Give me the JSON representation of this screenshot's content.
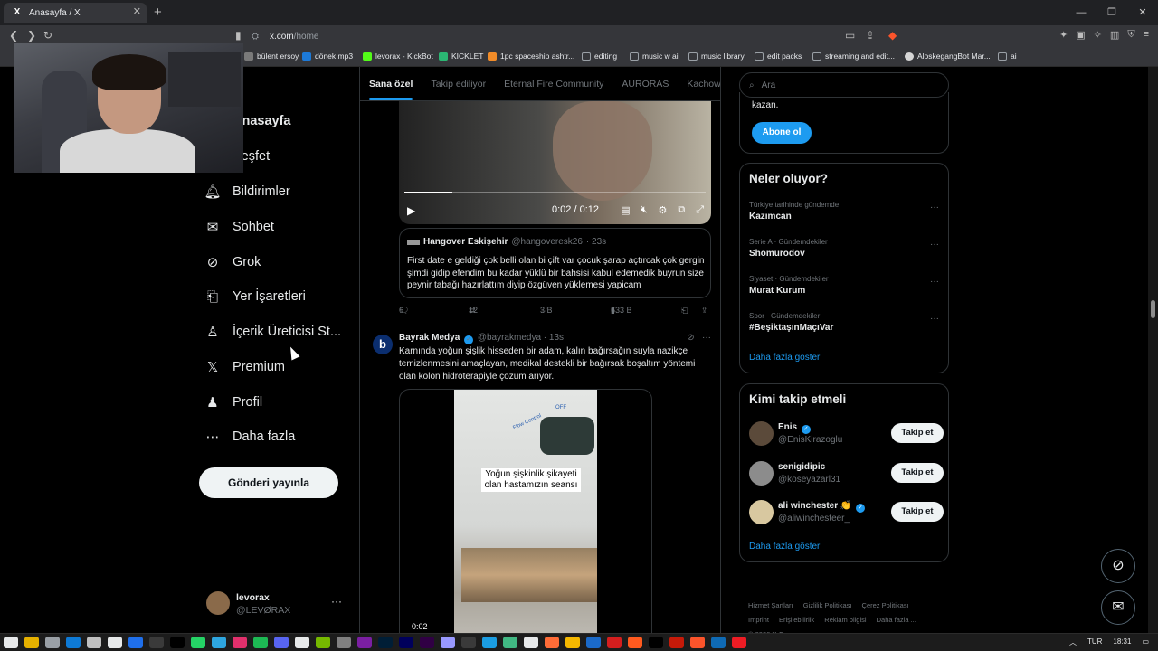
{
  "browser": {
    "tab_title": "Anasayfa / X",
    "tab_favicon": "X",
    "url_host": "x.com",
    "url_path": "/home",
    "bookmarks": [
      "bülent ersoy",
      "dönek mp3",
      "levorax - KickBot",
      "KICKLET",
      "1pc spaceship ashtr...",
      "editing",
      "music w ai",
      "music library",
      "edit packs",
      "streaming and edit...",
      "AloskegangBot Mar...",
      "ai"
    ],
    "bookmark_colors": [
      "#7a7a7a",
      "#1d7ad8",
      "#53fc18",
      "#2bb673",
      "#f28c28",
      "#9aa0a6",
      "#9aa0a6",
      "#9aa0a6",
      "#9aa0a6",
      "#9aa0a6",
      "#d6d6d6",
      "#9aa0a6"
    ]
  },
  "nav": {
    "items": [
      {
        "label": "Anasayfa",
        "icon": "home-icon"
      },
      {
        "label": "Keşfet",
        "icon": "search-icon"
      },
      {
        "label": "Bildirimler",
        "icon": "bell-icon"
      },
      {
        "label": "Sohbet",
        "icon": "envelope-icon"
      },
      {
        "label": "Grok",
        "icon": "grok-icon"
      },
      {
        "label": "Yer İşaretleri",
        "icon": "bookmark-icon"
      },
      {
        "label": "İçerik Üreticisi St...",
        "icon": "creator-icon"
      },
      {
        "label": "Premium",
        "icon": "x-logo-icon"
      },
      {
        "label": "Profil",
        "icon": "person-icon"
      },
      {
        "label": "Daha fazla",
        "icon": "more-circle-icon"
      }
    ],
    "post_button": "Gönderi yayınla",
    "account_name": "levorax",
    "account_handle": "@LEVØRAX"
  },
  "feed": {
    "tabs": [
      "Sana özel",
      "Takip ediliyor",
      "Eternal Fire Community",
      "AURORAS",
      "Kachow"
    ],
    "video1": {
      "time": "0:02 / 0:12",
      "progress": 0.16
    },
    "quote": {
      "name": "Hangover Eskişehir",
      "handle": "@hangoveresk26",
      "time": "· 23s",
      "text": "First date e geldiği çok belli olan bi çift var çocuk şarap açtırcak çok gergin şimdi gidip efendim bu kadar yüklü bir bahsisi kabul edemedik buyrun size peynir tabağı hazırlattım diyip özgüven yüklemesi yapicam"
    },
    "actions1": {
      "replies": "6",
      "reposts": "12",
      "likes": "3 B",
      "views": "633 B"
    },
    "tweet2": {
      "name": "Bayrak Medya",
      "handle": "@bayrakmedya",
      "time": "· 13s",
      "avatar_letter": "b",
      "text": "Karnında yoğun şişlik hisseden bir adam, kalın bağırsağın suyla nazikçe temizlenmesini amaçlayan, medikal destekli bir bağırsak boşaltım yöntemi olan kolon hidroterapiyle çözüm arıyor.",
      "media_caption": "Yoğun şişkinlik şikayeti olan hastamızın seansı",
      "media_label_flow": "Flow Control",
      "media_label_off": "OFF",
      "media_time": "0:02"
    }
  },
  "sidebar": {
    "search_placeholder": "Ara",
    "premium_text": "kazan.",
    "subscribe_button": "Abone ol",
    "trends_title": "Neler oluyor?",
    "trends": [
      {
        "meta": "Türkiye tarihinde gündemde",
        "name": "Kazımcan"
      },
      {
        "meta": "Serie A · Gündemdekiler",
        "name": "Shomurodov"
      },
      {
        "meta": "Siyaset · Gündemdekiler",
        "name": "Murat Kurum"
      },
      {
        "meta": "Spor · Gündemdekiler",
        "name": "#BeşiktaşınMaçıVar"
      }
    ],
    "trends_more": "Daha fazla göster",
    "who_title": "Kimi takip etmeli",
    "who": [
      {
        "name": "Enis",
        "handle": "@EnisKirazoglu",
        "verified": true,
        "color": "#5b4a3a"
      },
      {
        "name": "senigidipic",
        "handle": "@koseyazarl31",
        "verified": false,
        "color": "#8c8c8c"
      },
      {
        "name": "ali winchester 👏",
        "handle": "@aliwinchesteer_",
        "verified": true,
        "color": "#d8c8a0"
      }
    ],
    "follow_button": "Takip et",
    "who_more": "Daha fazla göster",
    "footer": [
      "Hizmet Şartları",
      "Gizlilik Politikası",
      "Çerez Politikası",
      "Imprint",
      "Erişilebilirlik",
      "Reklam bilgisi",
      "Daha fazla ...",
      "© 2026 X Corp."
    ]
  },
  "taskbar": {
    "lang": "TUR",
    "clock": "18:31",
    "icon_colors": [
      "#e7e9ea",
      "#e6b100",
      "#9aa0a6",
      "#0e7ad6",
      "#c0c0c0",
      "#e7e9ea",
      "#1f6feb",
      "#3a3a3a",
      "#000000",
      "#25d366",
      "#2ea6e0",
      "#e1306c",
      "#1db954",
      "#5865f2",
      "#e7e9ea",
      "#76b900",
      "#808080",
      "#7b1fa2",
      "#001e36",
      "#00005b",
      "#300044",
      "#9999ff",
      "#3a3a3a",
      "#1b9de2",
      "#41b883",
      "#e7e9ea",
      "#ff6c37",
      "#f5b800",
      "#1b6ac9",
      "#d41e1e",
      "#ff5a1f",
      "#000000",
      "#c61a09",
      "#fb542b",
      "#0f6ab4",
      "#ed1c24"
    ]
  }
}
